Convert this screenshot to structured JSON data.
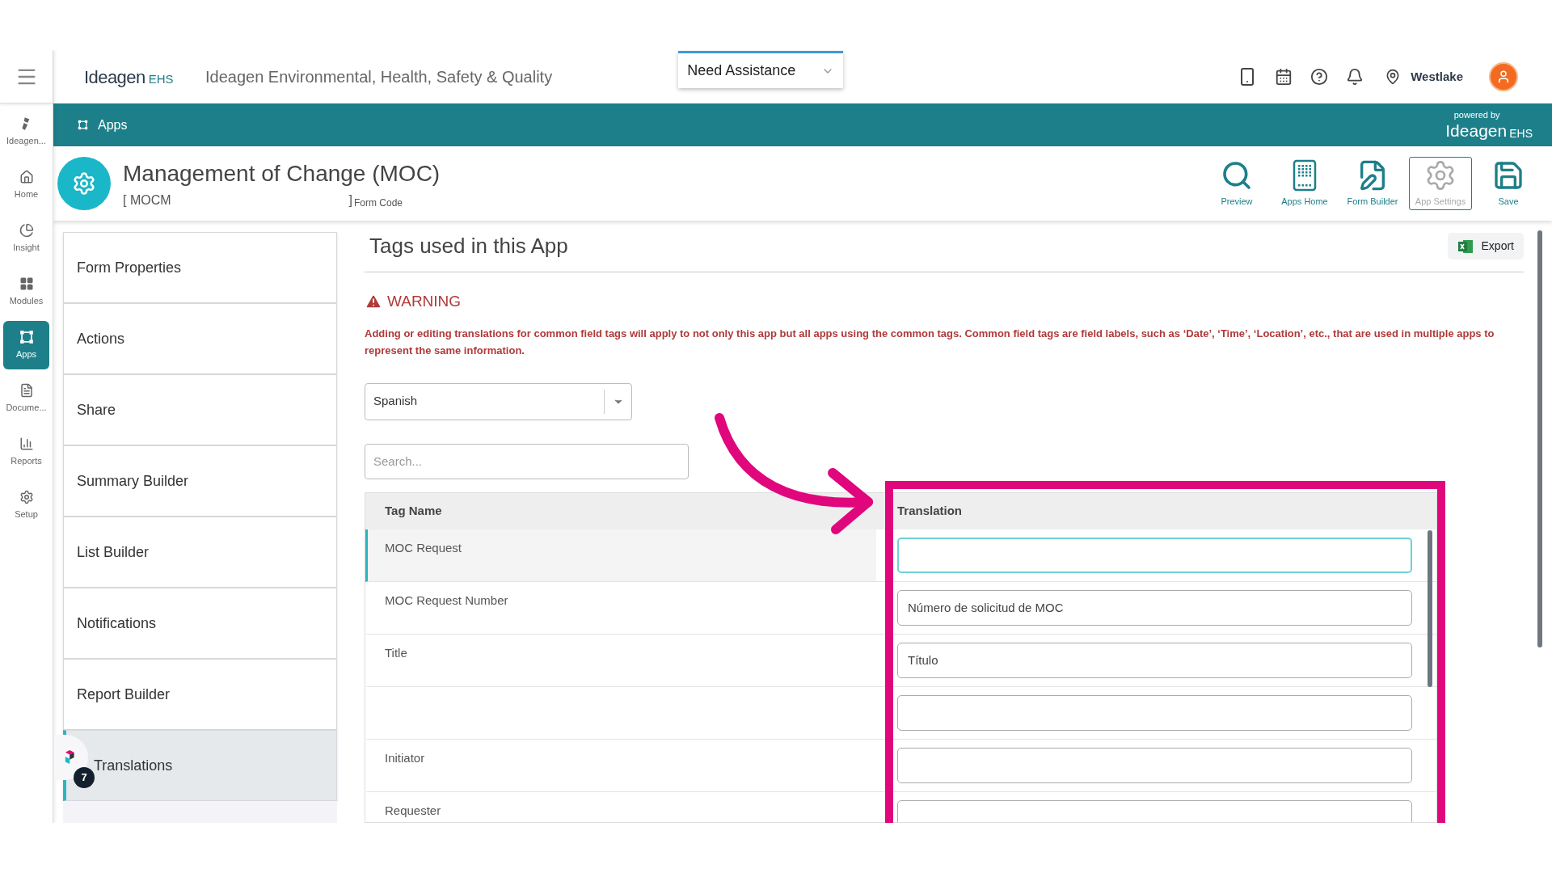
{
  "header": {
    "logo": {
      "name": "Ideagen",
      "suffix": "EHS"
    },
    "app_title": "Ideagen Environmental, Health, Safety & Quality",
    "assistance": "Need Assistance",
    "location": "Westlake"
  },
  "rail": [
    {
      "kind": "ideagen",
      "label": "Ideagen...",
      "selected": false
    },
    {
      "kind": "home",
      "label": "Home",
      "selected": false
    },
    {
      "kind": "insight",
      "label": "Insight",
      "selected": false
    },
    {
      "kind": "modules",
      "label": "Modules",
      "selected": false
    },
    {
      "kind": "apps",
      "label": "Apps",
      "selected": true
    },
    {
      "kind": "documents",
      "label": "Docume...",
      "selected": false
    },
    {
      "kind": "reports",
      "label": "Reports",
      "selected": false
    },
    {
      "kind": "setup",
      "label": "Setup",
      "selected": false
    }
  ],
  "breadcrumb": "Apps",
  "powered_by": {
    "caption": "powered by",
    "name": "Ideagen",
    "suffix": "EHS"
  },
  "form": {
    "title": "Management of Change (MOC)",
    "code_open": "[ MOCM",
    "code_close": "]",
    "code_label": "Form Code"
  },
  "toolbar": [
    {
      "kind": "preview",
      "label": "Preview",
      "disabled": false
    },
    {
      "kind": "apps_home",
      "label": "Apps Home",
      "disabled": false
    },
    {
      "kind": "form_builder",
      "label": "Form Builder",
      "disabled": false
    },
    {
      "kind": "app_settings",
      "label": "App Settings",
      "disabled": true
    },
    {
      "kind": "save",
      "label": "Save",
      "disabled": false
    }
  ],
  "nav": [
    {
      "label": "Form Properties",
      "selected": false
    },
    {
      "label": "Actions",
      "selected": false
    },
    {
      "label": "Share",
      "selected": false
    },
    {
      "label": "Summary Builder",
      "selected": false
    },
    {
      "label": "List Builder",
      "selected": false
    },
    {
      "label": "Notifications",
      "selected": false
    },
    {
      "label": "Report Builder",
      "selected": false
    },
    {
      "label": "Translations",
      "selected": true
    }
  ],
  "help_badge": "7",
  "content": {
    "heading": "Tags used in this App",
    "export": "Export",
    "warning_title": "WARNING",
    "warning_text": "Adding or editing translations for common field tags will apply to not only this app but all apps using the common tags. Common field tags are field labels, such as ‘Date’, ‘Time’, ‘Location’, etc., that are used in multiple apps to represent the same information.",
    "language": "Spanish",
    "search": {
      "placeholder": "Search..."
    },
    "table": {
      "columns": [
        "Tag Name",
        "Translation"
      ],
      "rows": [
        {
          "tag": "MOC Request",
          "translation": "",
          "selected": true
        },
        {
          "tag": "MOC Request Number",
          "translation": "Número de solicitud de MOC",
          "selected": false
        },
        {
          "tag": "Title",
          "translation": "Título",
          "selected": false
        },
        {
          "translation": "",
          "selected": false
        },
        {
          "tag": "Initiator",
          "translation": "",
          "selected": false
        },
        {
          "tag": "Requester",
          "translation": "",
          "selected": false
        }
      ]
    }
  }
}
